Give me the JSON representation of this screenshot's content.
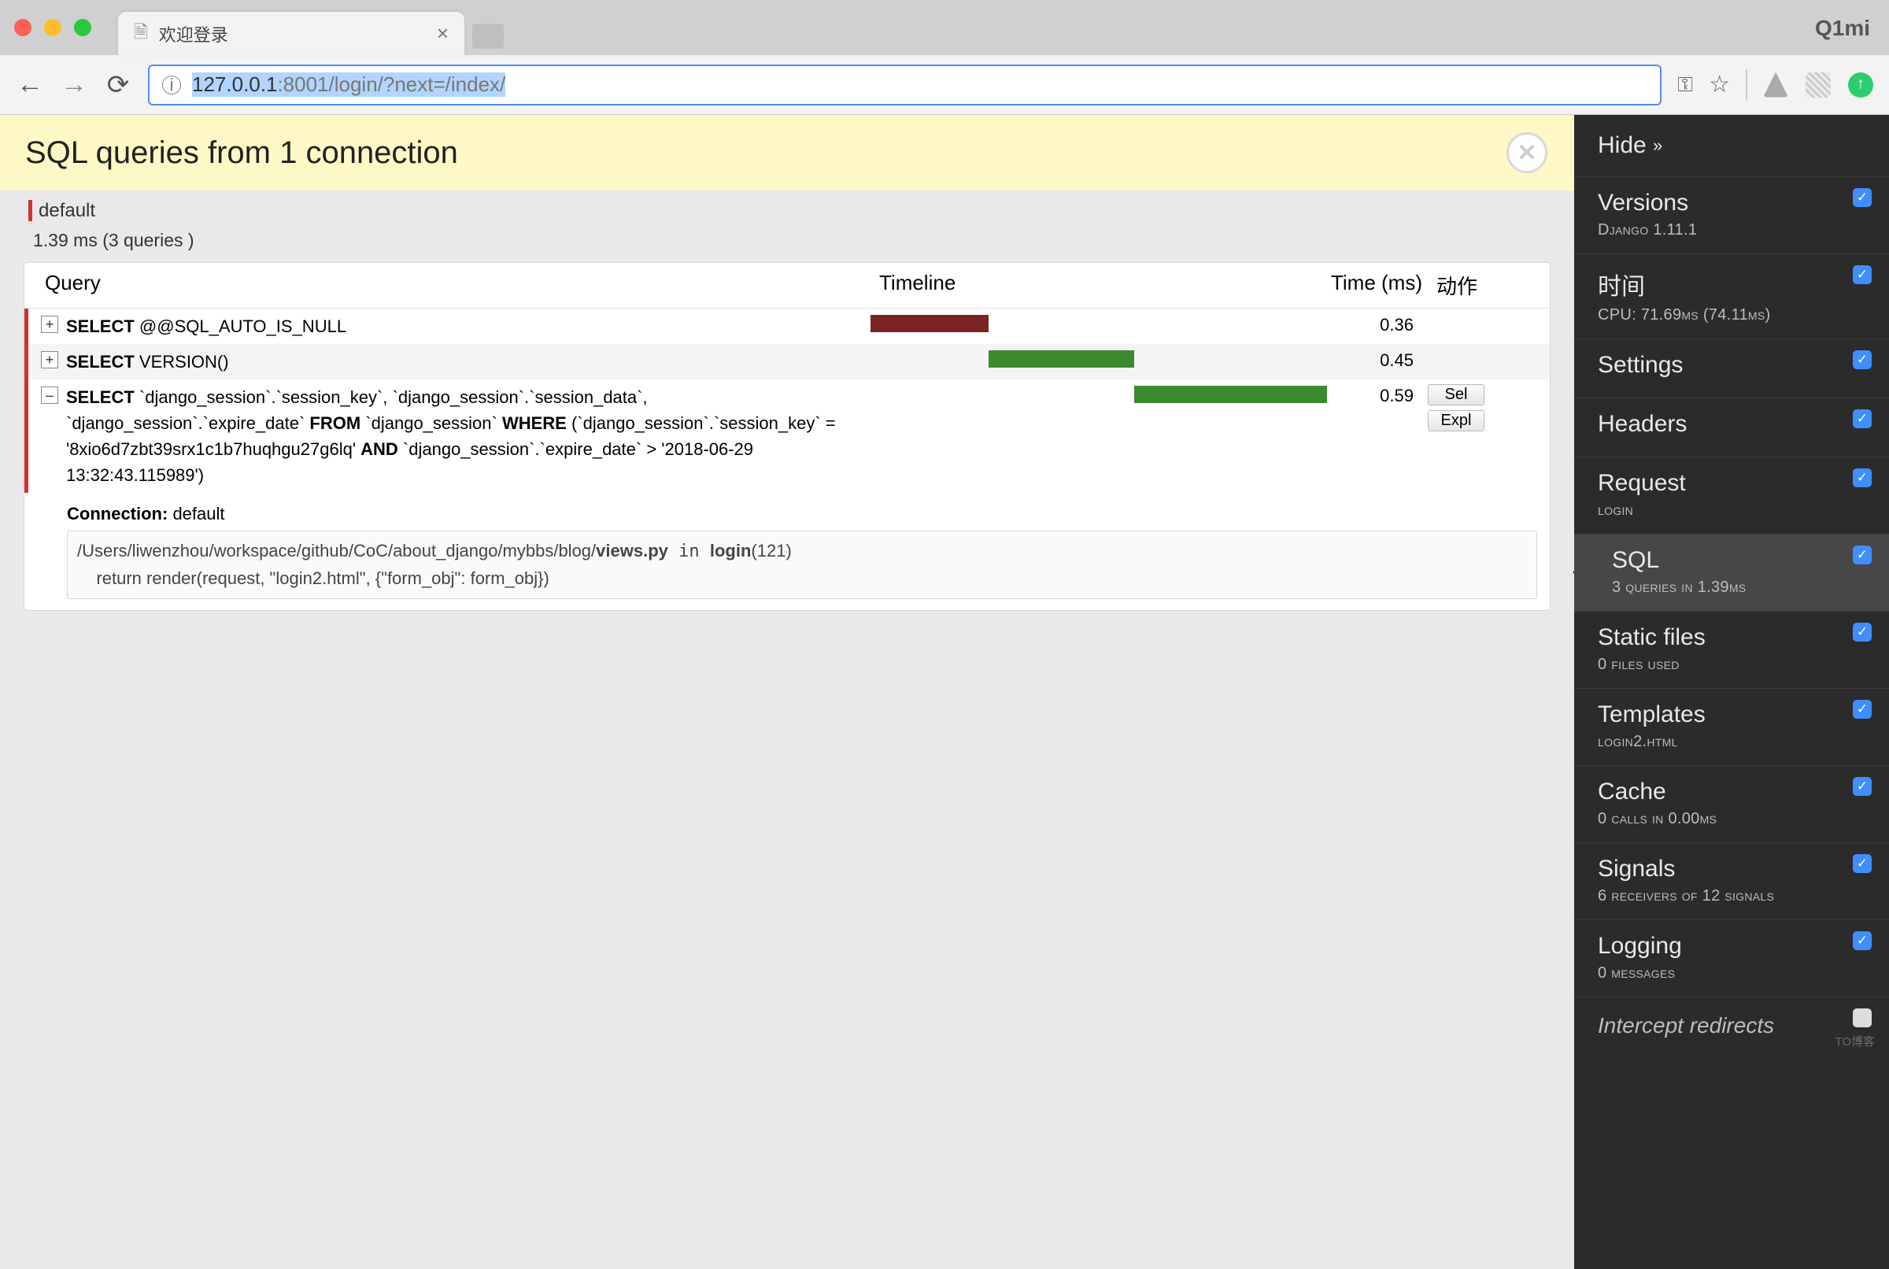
{
  "browser": {
    "profile": "Q1mi",
    "tab_title": "欢迎登录",
    "url_host": "127.0.0.1",
    "url_path": ":8001/login/?next=/index/"
  },
  "header": {
    "title": "SQL queries from 1 connection"
  },
  "connection": {
    "name": "default",
    "summary": "1.39 ms (3 queries )"
  },
  "columns": {
    "query": "Query",
    "timeline": "Timeline",
    "time": "Time (ms)",
    "action": "动作"
  },
  "rows": [
    {
      "kw": "SELECT",
      "rest": " @@SQL_AUTO_IS_NULL",
      "time": "0.36",
      "expanded": false
    },
    {
      "kw": "SELECT",
      "rest": " VERSION()",
      "time": "0.45",
      "expanded": false
    },
    {
      "kw": "SELECT",
      "html": " `django_session`.`session_key`, `django_session`.`session_data`, `django_session`.`expire_date` <b>FROM</b> `django_session` <b>WHERE</b> (`django_session`.`session_key` = '8xio6d7zbt39srx1c1b7huqhgu27g6lq' <b>AND</b> `django_session`.`expire_date` > '2018-06-29 13:32:43.115989')",
      "time": "0.59",
      "expanded": true
    }
  ],
  "buttons": {
    "sel": "Sel",
    "expl": "Expl"
  },
  "expanded": {
    "conn_label": "Connection:",
    "conn_value": " default",
    "code_path_pre": "/Users/liwenzhou/workspace/github/CoC/about_django/mybbs/blog/",
    "code_file": "views.py",
    "code_in": " in ",
    "code_fn": "login",
    "code_args": "(121)",
    "code_line": "    return render(request, \"login2.html\", {\"form_obj\": form_obj})"
  },
  "sidebar": {
    "hide": "Hide",
    "panels": [
      {
        "title": "Versions",
        "sub": "Django 1.11.1",
        "checked": true,
        "active": false
      },
      {
        "title": "时间",
        "sub": "CPU: 71.69ms (74.11ms)",
        "checked": true,
        "active": false
      },
      {
        "title": "Settings",
        "sub": "",
        "checked": true,
        "active": false
      },
      {
        "title": "Headers",
        "sub": "",
        "checked": true,
        "active": false
      },
      {
        "title": "Request",
        "sub": "login",
        "checked": true,
        "active": false
      },
      {
        "title": "SQL",
        "sub": "3 queries in 1.39ms",
        "checked": true,
        "active": true
      },
      {
        "title": "Static files",
        "sub": "0 files used",
        "checked": true,
        "active": false
      },
      {
        "title": "Templates",
        "sub": "login2.html",
        "checked": true,
        "active": false
      },
      {
        "title": "Cache",
        "sub": "0 calls in 0.00ms",
        "checked": true,
        "active": false
      },
      {
        "title": "Signals",
        "sub": "6 receivers of 12 signals",
        "checked": true,
        "active": false
      },
      {
        "title": "Logging",
        "sub": "0 messages",
        "checked": true,
        "active": false
      }
    ],
    "last": "Intercept redirects",
    "watermark": "TO博客"
  }
}
